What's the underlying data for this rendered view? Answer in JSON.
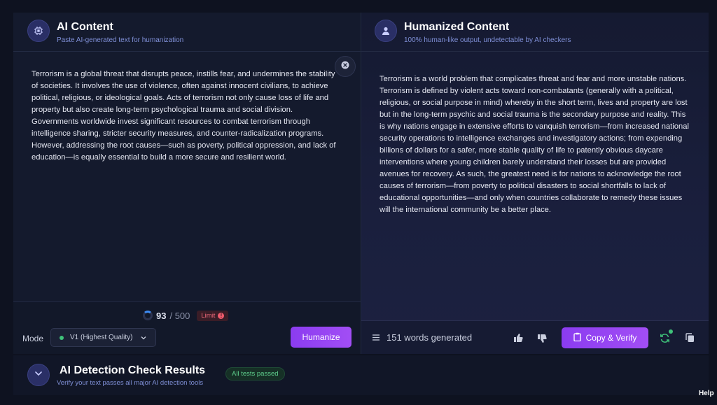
{
  "ai_panel": {
    "title": "AI Content",
    "subtitle": "Paste AI-generated text for humanization",
    "icon": "chip-icon",
    "text": "Terrorism is a global threat that disrupts peace, instills fear, and undermines the stability of societies. It involves the use of violence, often against innocent civilians, to achieve political, religious, or ideological goals. Acts of terrorism not only cause loss of life and property but also create long-term psychological trauma and social division. Governments worldwide invest significant resources to combat terrorism through intelligence sharing, stricter security measures, and counter-radicalization programs. However, addressing the root causes—such as poverty, political oppression, and lack of education—is equally essential to build a more secure and resilient world.",
    "word_count": "93",
    "word_max": "/ 500",
    "limit_label": "Limit",
    "mode_label": "Mode",
    "mode_value": "V1 (Highest Quality)",
    "humanize_label": "Humanize"
  },
  "human_panel": {
    "title": "Humanized Content",
    "subtitle": "100% human-like output, undetectable by AI checkers",
    "icon": "user-icon",
    "text": "Terrorism is a world problem that complicates threat and fear and more unstable nations. Terrorism is defined by violent acts toward non-combatants (generally with a political, religious, or social purpose in mind) whereby in the short term, lives and property are lost but in the long-term psychic and social trauma is the secondary purpose and reality. This is why nations engage in extensive efforts to vanquish terrorism—from increased national security operations to intelligence exchanges and investigatory actions; from expending billions of dollars for a safer, more stable quality of life to patently obvious daycare interventions where young children barely understand their losses but are provided avenues for recovery. As such, the greatest need is for nations to acknowledge the root causes of terrorism—from poverty to political disasters to social shortfalls to lack of educational opportunities—and only when countries collaborate to remedy these issues will the international community be a better place.",
    "words_generated": "151 words generated",
    "copy_label": "Copy & Verify"
  },
  "detection": {
    "title": "AI Detection Check Results",
    "subtitle": "Verify your text passes all major AI detection tools",
    "status": "All tests passed"
  },
  "help_label": "Help",
  "colors": {
    "accent": "#9b4af3",
    "success": "#3fc27a",
    "danger": "#ef5b6c",
    "background": "#0e1220"
  }
}
